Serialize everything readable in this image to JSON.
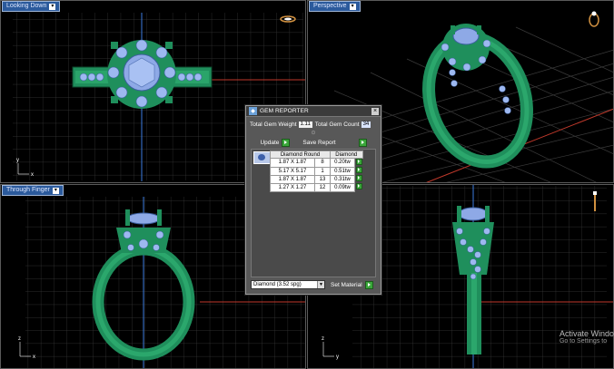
{
  "viewports": {
    "top_left": {
      "label": "Looking Down"
    },
    "top_right": {
      "label": "Perspective"
    },
    "bottom_left": {
      "label": "Through Finger"
    },
    "bottom_right": {
      "label": ""
    }
  },
  "gem_reporter": {
    "title": "GEM REPORTER",
    "total_weight_label": "Total Gem Weight",
    "total_weight_value": "1.11",
    "total_count_label": "Total Gem Count",
    "total_count_value": "34",
    "update_label": "Update",
    "save_report_label": "Save Report",
    "columns": [
      "Diamond Round",
      "Diamond"
    ],
    "rows": [
      {
        "size": "1.87 X 1.87",
        "count": "8",
        "weight": "0.20tw"
      },
      {
        "size": "5.17 X 5.17",
        "count": "1",
        "weight": "0.51tw"
      },
      {
        "size": "1.87 X 1.87",
        "count": "13",
        "weight": "0.31tw"
      },
      {
        "size": "1.27 X 1.27",
        "count": "12",
        "weight": "0.09tw"
      }
    ],
    "material_select": "Diamond    (3.52 spg)",
    "set_material_label": "Set Material"
  },
  "watermark": {
    "line1": "Activate Windo",
    "line2": "Go to Settings to"
  },
  "colors": {
    "metal": "#1f8f5c",
    "gem": "#9db8f0",
    "grid": "#3a3a3a",
    "axis_red": "#c0392b",
    "axis_blue": "#3b7de0",
    "label_bg": "#2b5a9c"
  }
}
